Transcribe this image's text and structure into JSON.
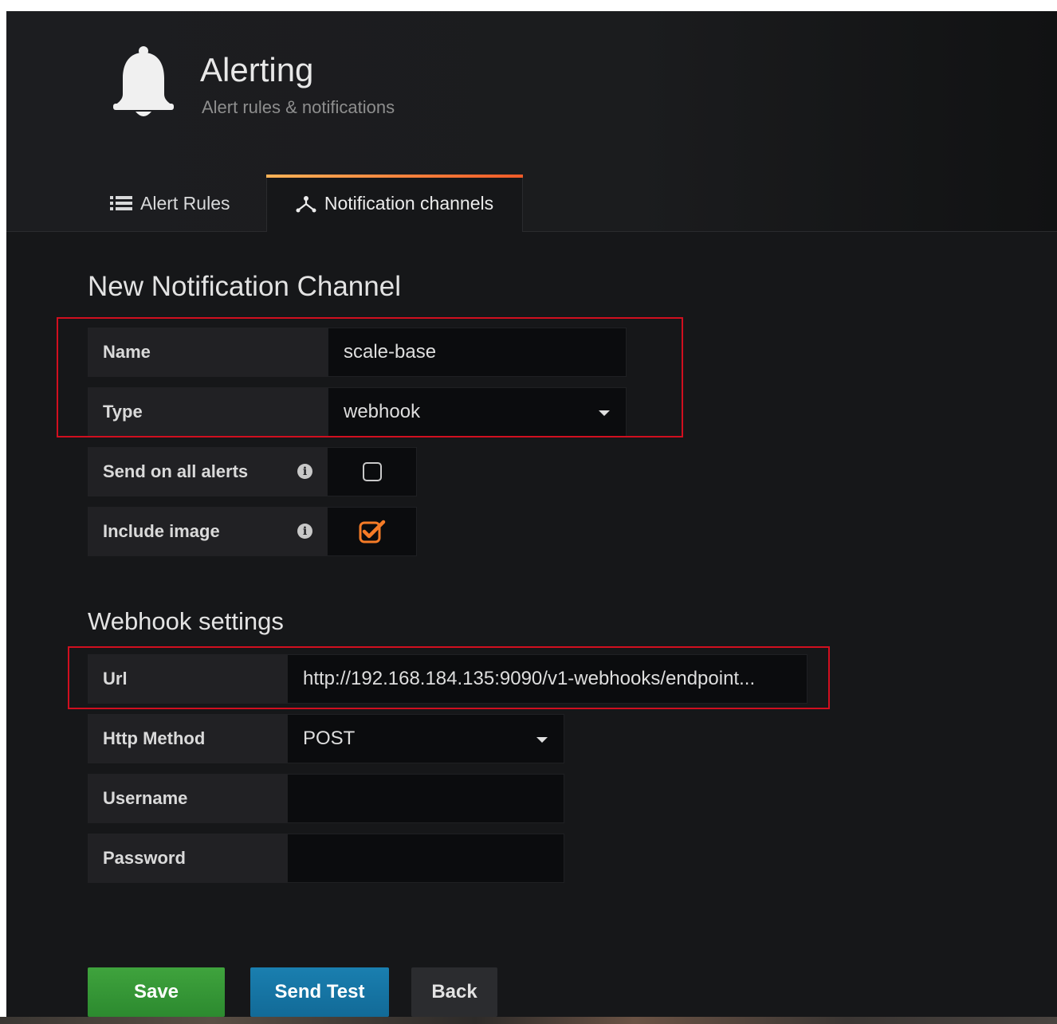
{
  "header": {
    "title": "Alerting",
    "subtitle": "Alert rules & notifications",
    "icon": "bell-icon"
  },
  "tabs": [
    {
      "label": "Alert Rules",
      "icon": "list-icon",
      "active": false
    },
    {
      "label": "Notification channels",
      "icon": "sitemap-icon",
      "active": true
    }
  ],
  "form": {
    "title": "New Notification Channel",
    "name": {
      "label": "Name",
      "value": "scale-base"
    },
    "type": {
      "label": "Type",
      "value": "webhook"
    },
    "send_on_all_alerts": {
      "label": "Send on all alerts",
      "checked": false
    },
    "include_image": {
      "label": "Include image",
      "checked": true
    }
  },
  "webhook": {
    "title": "Webhook settings",
    "url": {
      "label": "Url",
      "value": "http://192.168.184.135:9090/v1-webhooks/endpoint..."
    },
    "http_method": {
      "label": "Http Method",
      "value": "POST"
    },
    "username": {
      "label": "Username",
      "value": ""
    },
    "password": {
      "label": "Password",
      "value": ""
    }
  },
  "buttons": {
    "save": "Save",
    "send_test": "Send Test",
    "back": "Back"
  },
  "colors": {
    "accent": "#f05a28",
    "save": "#2f8f32",
    "send_test": "#1576a6",
    "highlight": "#d10f1f"
  }
}
